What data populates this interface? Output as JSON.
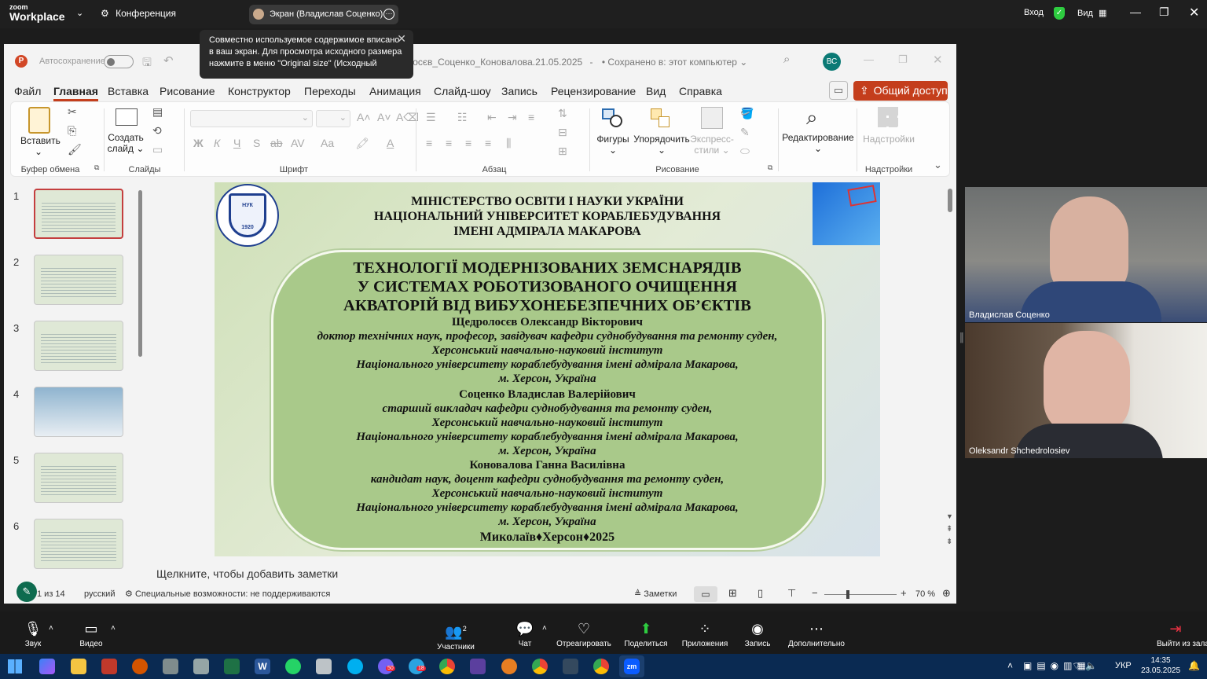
{
  "zoom_top": {
    "logo_small": "zoom",
    "logo_big": "Workplace",
    "conference_label": "Конференция",
    "share_label": "Экран (Владислав Соценко)",
    "login_label": "Вход",
    "view_label": "Вид"
  },
  "tooltip": {
    "text": "Совместно используемое содержимое вписано в ваш экран. Для просмотра исходного размера нажмите в меню \"Original size\" (Исходный"
  },
  "ppt": {
    "autosave_label": "Автосохранение",
    "file_title": "ролосєв_Соценко_Коновалова.21.05.2025",
    "file_title_suffix": "-",
    "saved_status": "• Сохранено в: этот компьютер",
    "avatar_initials": "ВС",
    "menu": [
      "Файл",
      "Главная",
      "Вставка",
      "Рисование",
      "Конструктор",
      "Переходы",
      "Анимация",
      "Слайд-шоу",
      "Запись",
      "Рецензирование",
      "Вид",
      "Справка"
    ],
    "share_button": "Общий доступ",
    "ribbon": {
      "paste": "Вставить",
      "create_slide_1": "Создать",
      "create_slide_2": "слайд",
      "shapes": "Фигуры",
      "arrange": "Упорядочить",
      "express_1": "Экспресс-",
      "express_2": "стили",
      "editing": "Редактирование",
      "addins": "Надстройки",
      "group_clipboard": "Буфер обмена",
      "group_slides": "Слайды",
      "group_font": "Шрифт",
      "group_paragraph": "Абзац",
      "group_drawing": "Рисование",
      "group_addins": "Надстройки",
      "font_b": "Ж",
      "font_i": "К",
      "font_u": "Ч",
      "font_s": "S",
      "font_ab": "ab",
      "font_av": "AV",
      "font_aa": "Aa"
    },
    "thumbnails": [
      "1",
      "2",
      "3",
      "4",
      "5",
      "6"
    ],
    "notes_placeholder": "Щелкните, чтобы добавить заметки",
    "status": {
      "slide_counter": "1 из 14",
      "language": "русский",
      "accessibility": "Специальные возможности: не поддерживаются",
      "notes": "Заметки",
      "zoom": "70 %"
    }
  },
  "slide": {
    "header": [
      "МІНІСТЕРСТВО ОСВІТИ І НАУКИ УКРАЇНИ",
      "НАЦІОНАЛЬНИЙ УНІВЕРСИТЕТ КОРАБЛЕБУДУВАННЯ",
      "ІМЕНІ АДМІРАЛА МАКАРОВА"
    ],
    "title": [
      "ТЕХНОЛОГІЇ МОДЕРНІЗОВАНИХ ЗЕМСНАРЯДІВ",
      "У СИСТЕМАХ   РОБОТИЗОВАНОГО ОЧИЩЕННЯ",
      "АКВАТОРІЙ ВІД ВИБУХОНЕБЕЗПЕЧНИХ ОБ’ЄКТІВ"
    ],
    "author1_name": "Щедролосєв Олександр Вікторович",
    "author1_role": "доктор технічних наук, професор, завідувач кафедри суднобудування та ремонту суден,",
    "author2_name": "Соценко Владислав Валерійович",
    "author2_role": "старший викладач кафедри суднобудування та ремонту суден,",
    "author3_name": "Коновалова Ганна Василівна",
    "author3_role": "кандидат наук, доцент кафедри суднобудування та ремонту суден,",
    "institute": "Херсонський навчально-науковий інститут",
    "university": "Національного університету кораблебудування імені адмірала Макарова,",
    "city": "м. Херсон, Україна",
    "footer": "Миколаїв♦Херсон♦2025",
    "logo_year": "1920",
    "logo_abbr": "НУК"
  },
  "videos": [
    {
      "name": "Владислав Соценко"
    },
    {
      "name": "Oleksandr Shchedrolosiev"
    }
  ],
  "zoom_bottom": {
    "audio": "Звук",
    "video": "Видео",
    "participants": "Участники",
    "participants_count": "2",
    "chat": "Чат",
    "react": "Отреагировать",
    "share": "Поделиться",
    "apps": "Приложения",
    "record": "Запись",
    "more": "Дополнительно",
    "leave": "Выйти из зала"
  },
  "taskbar": {
    "language": "УКР",
    "time": "14:35",
    "date": "23.05.2025",
    "badge_viber": "50",
    "badge_telegram": "18"
  }
}
